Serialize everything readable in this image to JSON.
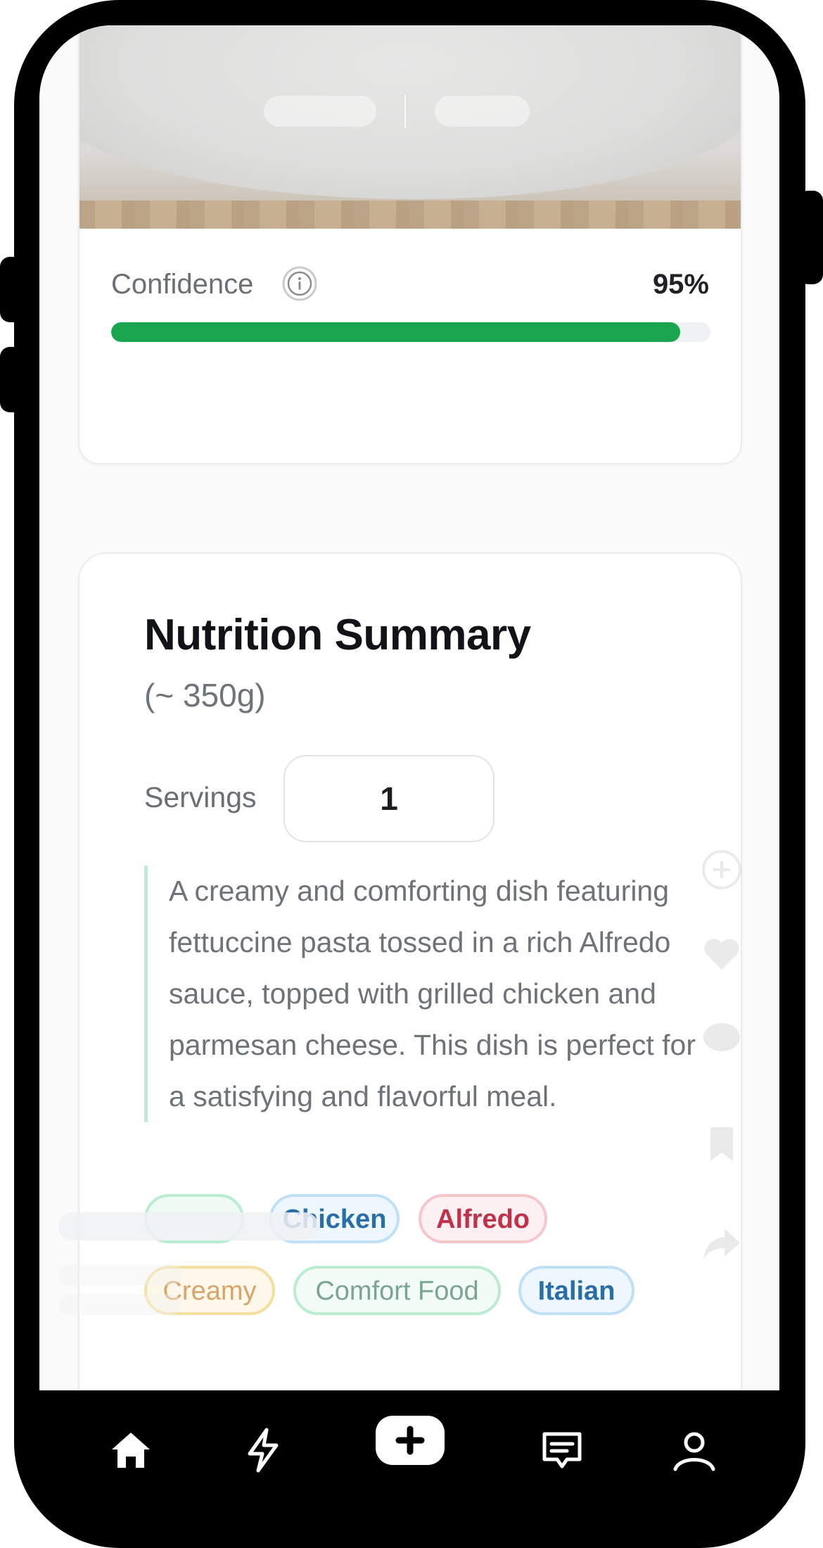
{
  "confidence": {
    "label": "Confidence",
    "value_text": "95%",
    "value": 0.95
  },
  "nutrition": {
    "title": "Nutrition Summary",
    "weight": "(~ 350g)",
    "servings_label": "Servings",
    "servings_value": "1",
    "description": "A creamy and comforting dish featuring fettuccine pasta tossed in a rich Alfredo sauce, topped with grilled chicken and parmesan cheese. This dish is perfect for a satisfying and flavorful meal.",
    "tags": [
      "Chicken",
      "Alfredo",
      "Creamy",
      "Comfort Food",
      "Italian"
    ]
  },
  "icons": {
    "info": "info-icon",
    "nav": [
      "home-icon",
      "lightning-icon",
      "add-icon",
      "chat-icon",
      "profile-icon"
    ]
  },
  "colors": {
    "accent_green": "#1aa64f",
    "progress_track": "#f0f1f2"
  }
}
